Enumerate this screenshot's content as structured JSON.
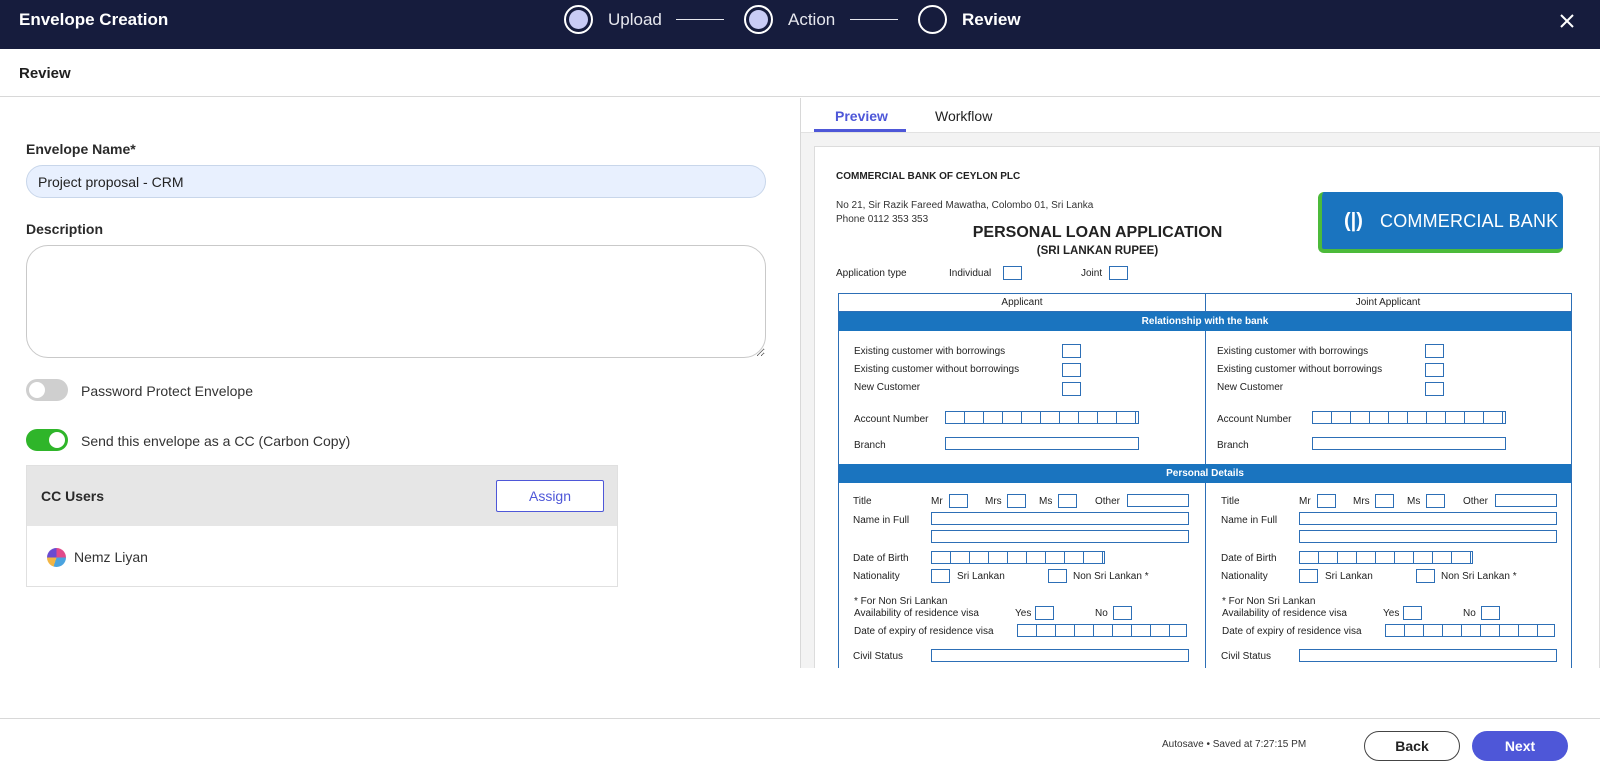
{
  "header": {
    "app_title": "Envelope Creation",
    "steps": [
      {
        "label": "Upload",
        "state": "done"
      },
      {
        "label": "Action",
        "state": "done"
      },
      {
        "label": "Review",
        "state": "current"
      }
    ],
    "close_icon": "close-icon"
  },
  "subheader": {
    "title": "Review"
  },
  "form": {
    "envelope_name_label": "Envelope Name*",
    "envelope_name_value": "Project proposal - CRM",
    "description_label": "Description",
    "description_value": "",
    "password_toggle_label": "Password Protect Envelope",
    "password_toggle_on": false,
    "cc_toggle_label": "Send this envelope as a CC (Carbon Copy)",
    "cc_toggle_on": true
  },
  "cc_panel": {
    "title": "CC Users",
    "assign_label": "Assign",
    "users": [
      {
        "name": "Nemz Liyan"
      }
    ]
  },
  "preview": {
    "tabs": [
      {
        "label": "Preview",
        "active": true
      },
      {
        "label": "Workflow",
        "active": false
      }
    ],
    "document": {
      "bank_name": "COMMERCIAL BANK OF CEYLON PLC",
      "address_line1": "No 21, Sir Razik Fareed Mawatha, Colombo 01, Sri Lanka",
      "address_line2": "Phone 0112 353 353",
      "title": "PERSONAL LOAN APPLICATION",
      "subtitle": "(SRI LANKAN RUPEE)",
      "logo_text": "COMMERCIAL BANK",
      "application_type_label": "Application type",
      "individual_label": "Individual",
      "joint_label": "Joint",
      "col_applicant": "Applicant",
      "col_joint_applicant": "Joint Applicant",
      "band_relationship": "Relationship with the bank",
      "existing_with": "Existing customer with  borrowings",
      "existing_without": "Existing customer without  borrowings",
      "new_customer": "New Customer",
      "account_number": "Account Number",
      "branch": "Branch",
      "band_personal": "Personal Details",
      "title_label": "Title",
      "mr": "Mr",
      "mrs": "Mrs",
      "ms": "Ms",
      "other": "Other",
      "name_in_full": "Name in Full",
      "date_of_birth": "Date of Birth",
      "nationality": "Nationality",
      "sri_lankan": "Sri Lankan",
      "non_sri_lankan": "Non Sri Lankan *",
      "for_non_sl": "* For Non Sri Lankan",
      "availability_visa": "Availability of residence visa",
      "yes": "Yes",
      "no": "No",
      "expiry_visa": "Date of expiry of residence visa",
      "civil_status": "Civil Status"
    }
  },
  "footer": {
    "autosave_text": "Autosave • Saved at 7:27:15 PM",
    "back_label": "Back",
    "next_label": "Next"
  },
  "colors": {
    "topbar": "#161c3d",
    "accent": "#4e57d8",
    "toggle_on": "#2fb52a",
    "bank_blue": "#1a74bf"
  }
}
